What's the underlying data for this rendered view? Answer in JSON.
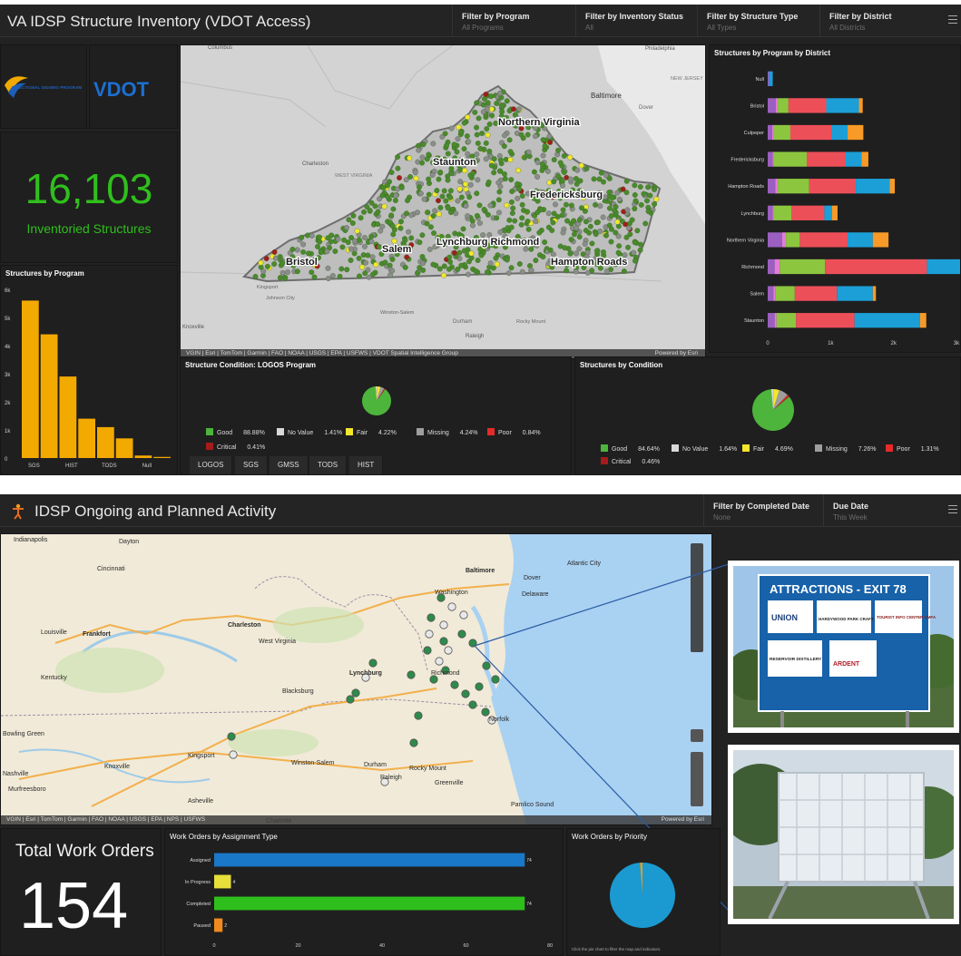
{
  "top": {
    "title": "VA IDSP Structure Inventory (VDOT Access)",
    "filters": [
      {
        "label": "Filter by Program",
        "value": "All Programs"
      },
      {
        "label": "Filter by Inventory Status",
        "value": "All"
      },
      {
        "label": "Filter by Structure Type",
        "value": "All Types"
      },
      {
        "label": "Filter by District",
        "value": "All Districts"
      }
    ],
    "logos": {
      "program_text": "DIRECTIONAL SIGNING PROGRAM",
      "vdot_text": "VDOT"
    },
    "kpi": {
      "value": "16,103",
      "caption": "Inventoried Structures"
    },
    "map": {
      "place_labels": [
        {
          "text": "Baltimore",
          "cls": "city"
        },
        {
          "text": "Northern Virginia",
          "cls": "district"
        },
        {
          "text": "Staunton",
          "cls": "district"
        },
        {
          "text": "Fredericksburg",
          "cls": "district"
        },
        {
          "text": "Lynchburg Richmond",
          "cls": "district"
        },
        {
          "text": "Salem",
          "cls": "district"
        },
        {
          "text": "Bristol",
          "cls": "district"
        },
        {
          "text": "Hampton Roads",
          "cls": "district"
        },
        {
          "text": "Charleston",
          "cls": "city"
        },
        {
          "text": "WEST VIRGINIA",
          "cls": "state"
        },
        {
          "text": "Knoxville",
          "cls": "city"
        },
        {
          "text": "Winston-Salem",
          "cls": "city"
        },
        {
          "text": "Durham",
          "cls": "city"
        },
        {
          "text": "Rocky Mount",
          "cls": "city"
        },
        {
          "text": "Raleigh",
          "cls": "city"
        },
        {
          "text": "Kingsport",
          "cls": "city"
        },
        {
          "text": "Johnson City",
          "cls": "city"
        },
        {
          "text": "Dover",
          "cls": "city"
        },
        {
          "text": "NEW JERSEY",
          "cls": "state"
        },
        {
          "text": "Philadelphia",
          "cls": "city"
        },
        {
          "text": "Columbus",
          "cls": "city"
        }
      ],
      "attribution": "VGIN | Esri | TomTom | Garmin | FAO | NOAA | USGS | EPA | USFWS | VDOT Spatial Intelligence Group",
      "powered": "Powered by Esri"
    },
    "condition_logos_title": "Structure Condition: LOGOS Program",
    "condition_all_title": "Structures by Condition",
    "tabs": [
      "LOGOS",
      "SGS",
      "GMSS",
      "TODS",
      "HIST"
    ],
    "program_title": "Structures by Program",
    "district_title": "Structures by Program by District"
  },
  "bottom": {
    "title": "IDSP Ongoing and Planned Activity",
    "filters": [
      {
        "label": "Filter by Completed Date",
        "value": "None"
      },
      {
        "label": "Due Date",
        "value": "This Week"
      }
    ],
    "map": {
      "place_labels": [
        "Indianapolis",
        "Dayton",
        "Cincinnati",
        "Baltimore",
        "Dover",
        "Washington",
        "Delaware",
        "Atlantic City",
        "Louisville",
        "Frankfort",
        "Charleston",
        "West Virginia",
        "Kentucky",
        "Lynchburg",
        "Blacksburg",
        "Richmond",
        "Bowling Green",
        "Kingsport",
        "Nashville",
        "Knoxville",
        "Murfreesboro",
        "Winston-Salem",
        "Durham",
        "Raleigh",
        "Rocky Mount",
        "Greenville",
        "Asheville",
        "Charlotte",
        "Norfolk",
        "Pamlico Sound"
      ],
      "attribution": "VGIN | Esri | TomTom | Garmin | FAO | NOAA | USGS | EPA | NPS | USFWS",
      "powered": "Powered by Esri"
    },
    "total": {
      "title": "Total Work Orders",
      "value": "154"
    },
    "assign_title": "Work Orders by Assignment Type",
    "priority_title": "Work Orders by Priority",
    "priority_note": "Click the pie chart to filter the map and indicators.",
    "photo_sign": {
      "header": "ATTRACTIONS - EXIT 78",
      "items": [
        "UNION",
        "HARDYWOOD PARK CRAFT BREWERY",
        "TOURIST INFO CENTER VMFA",
        "RESERVOIR DISTILLERY",
        "ARDENT"
      ]
    }
  },
  "chart_data": [
    {
      "id": "program",
      "type": "bar",
      "title": "Structures by Program",
      "categories": [
        "SGS",
        "",
        "HIST",
        "",
        "TODS",
        "",
        "Null",
        ""
      ],
      "values": [
        5600,
        4400,
        2900,
        1400,
        1100,
        700,
        90,
        40
      ],
      "ylim": [
        0,
        6000
      ],
      "yticks": [
        "0",
        "1k",
        "2k",
        "3k",
        "4k",
        "5k",
        "6k"
      ],
      "color": "#f2a900"
    },
    {
      "id": "district",
      "type": "bar",
      "title": "Structures by Program by District",
      "orientation": "horizontal",
      "categories": [
        "Null",
        "Bristol",
        "Culpeper",
        "Fredericksburg",
        "Hampton Roads",
        "Lynchburg",
        "Northern Virginia",
        "Richmond",
        "Salem",
        "Staunton"
      ],
      "series": [
        {
          "color": "#9b5fc0",
          "values": [
            20,
            130,
            70,
            80,
            120,
            80,
            230,
            110,
            90,
            110
          ]
        },
        {
          "color": "#e57cd8",
          "values": [
            0,
            30,
            30,
            20,
            40,
            20,
            60,
            80,
            30,
            30
          ]
        },
        {
          "color": "#8cc63f",
          "values": [
            0,
            170,
            260,
            520,
            500,
            280,
            220,
            720,
            310,
            310
          ]
        },
        {
          "color": "#ed4f59",
          "values": [
            0,
            600,
            650,
            620,
            740,
            520,
            760,
            1620,
            670,
            930
          ]
        },
        {
          "color": "#1c9fd7",
          "values": [
            60,
            520,
            260,
            250,
            540,
            120,
            400,
            1760,
            570,
            1040
          ]
        },
        {
          "color": "#f79a27",
          "values": [
            0,
            60,
            250,
            110,
            80,
            90,
            250,
            110,
            50,
            100
          ]
        }
      ],
      "xlim": [
        0,
        3000
      ],
      "xticks": [
        "0",
        "1k",
        "2k",
        "3k"
      ]
    },
    {
      "id": "logos_condition",
      "type": "pie",
      "title": "Structure Condition: LOGOS Program",
      "slices": [
        {
          "name": "Good",
          "value": 88.88,
          "label": "88.88%",
          "color": "#4db53b"
        },
        {
          "name": "No Value",
          "value": 1.41,
          "label": "1.41%",
          "color": "#d9d9d9"
        },
        {
          "name": "Fair",
          "value": 4.22,
          "label": "4.22%",
          "color": "#f5e52c"
        },
        {
          "name": "Missing",
          "value": 4.24,
          "label": "4.24%",
          "color": "#9e9e9e"
        },
        {
          "name": "Poor",
          "value": 0.84,
          "label": "0.84%",
          "color": "#e52a2a"
        },
        {
          "name": "Critical",
          "value": 0.41,
          "label": "0.41%",
          "color": "#a61b1b"
        }
      ]
    },
    {
      "id": "all_condition",
      "type": "pie",
      "title": "Structures by Condition",
      "slices": [
        {
          "name": "Good",
          "value": 84.64,
          "label": "84.64%",
          "color": "#4db53b"
        },
        {
          "name": "No Value",
          "value": 1.64,
          "label": "1.64%",
          "color": "#d9d9d9"
        },
        {
          "name": "Fair",
          "value": 4.69,
          "label": "4.69%",
          "color": "#f5e52c"
        },
        {
          "name": "Missing",
          "value": 7.26,
          "label": "7.26%",
          "color": "#9e9e9e"
        },
        {
          "name": "Poor",
          "value": 1.31,
          "label": "1.31%",
          "color": "#e52a2a"
        },
        {
          "name": "Critical",
          "value": 0.46,
          "label": "0.46%",
          "color": "#a61b1b"
        }
      ]
    },
    {
      "id": "assignment",
      "type": "bar",
      "orientation": "horizontal",
      "title": "Work Orders by Assignment Type",
      "categories": [
        "Assigned",
        "In Progress",
        "Completed",
        "Paused"
      ],
      "values": [
        74,
        4,
        74,
        2
      ],
      "colors": [
        "#1a78c8",
        "#e8e03a",
        "#2fbf1c",
        "#ee8a1e"
      ],
      "xlim": [
        0,
        80
      ],
      "xticks": [
        "0",
        "20",
        "40",
        "60",
        "80"
      ]
    },
    {
      "id": "priority",
      "type": "pie",
      "title": "Work Orders by Priority",
      "slices": [
        {
          "name": "",
          "value": 98.7,
          "color": "#1b9ad1"
        },
        {
          "name": "",
          "value": 1.3,
          "color": "#d2a13a"
        }
      ]
    }
  ],
  "colors": {
    "accent_green": "#2fbf1c",
    "bar_orange": "#f2a900",
    "dash_bg": "#1f1f1f"
  }
}
